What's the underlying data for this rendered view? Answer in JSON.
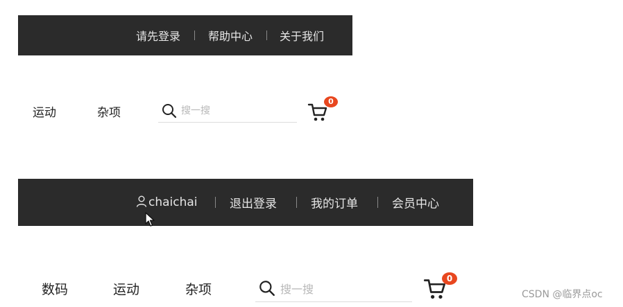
{
  "before_login": {
    "topbar": {
      "login": "请先登录",
      "help": "帮助中心",
      "about": "关于我们"
    },
    "nav": [
      "运动",
      "杂项"
    ],
    "search": {
      "placeholder": "搜一搜",
      "value": ""
    },
    "cart": {
      "count": "0"
    }
  },
  "after_login": {
    "topbar": {
      "username": "chaichai",
      "logout": "退出登录",
      "orders": "我的订单",
      "member": "会员中心"
    },
    "nav": [
      "数码",
      "运动",
      "杂项"
    ],
    "search": {
      "placeholder": "搜一搜",
      "value": ""
    },
    "cart": {
      "count": "0"
    }
  },
  "watermark": "CSDN @临界点oc",
  "colors": {
    "topbar_bg": "#2b2b2b",
    "topbar_text": "#e6e6e6",
    "badge": "#e8471f"
  },
  "icons": [
    "user-icon",
    "search-icon",
    "cart-icon",
    "mouse-cursor-icon"
  ]
}
